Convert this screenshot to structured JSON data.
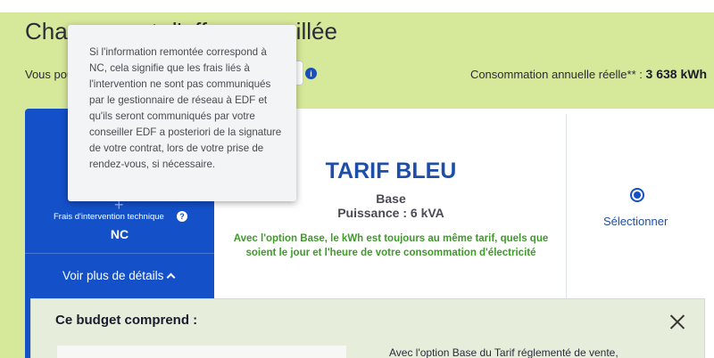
{
  "header": {
    "title": "Changement d'offre conseillée",
    "sub_left": "Vous pouvez",
    "info_icon": "i",
    "consumption_label": "Consommation annuelle réelle** :",
    "consumption_value": "3 638 kWh"
  },
  "tooltip": {
    "text": "Si l'information remontée correspond à NC, cela signifie que les frais liés à l'intervention ne sont pas communiqués par le gestionnaire de réseau à EDF et qu'ils seront communiqués par votre conseiller EDF a posteriori de la signature de votre contrat, lors de votre prise de rendez-vous, si nécessaire."
  },
  "card": {
    "plus": "+",
    "fee_label": "Frais d'intervention technique",
    "fee_help": "?",
    "fee_value": "NC",
    "details_link": "Voir plus de détails",
    "tariff_title": "TARIF BLEU",
    "option": "Base",
    "power": "Puissance : 6 kVA",
    "description": "Avec l'option Base, le kWh est toujours au même tarif, quels que soient le jour et l'heure de votre consommation d'électricité",
    "select_label": "Sélectionner",
    "selected": true
  },
  "panel": {
    "title": "Ce budget comprend :",
    "text": "Avec l'option Base du Tarif réglementé de vente,"
  },
  "colors": {
    "page_bg": "#d6e89a",
    "brand_blue": "#1450c8",
    "green_text": "#3f9a2a",
    "title_blue": "#1d4fa8"
  }
}
